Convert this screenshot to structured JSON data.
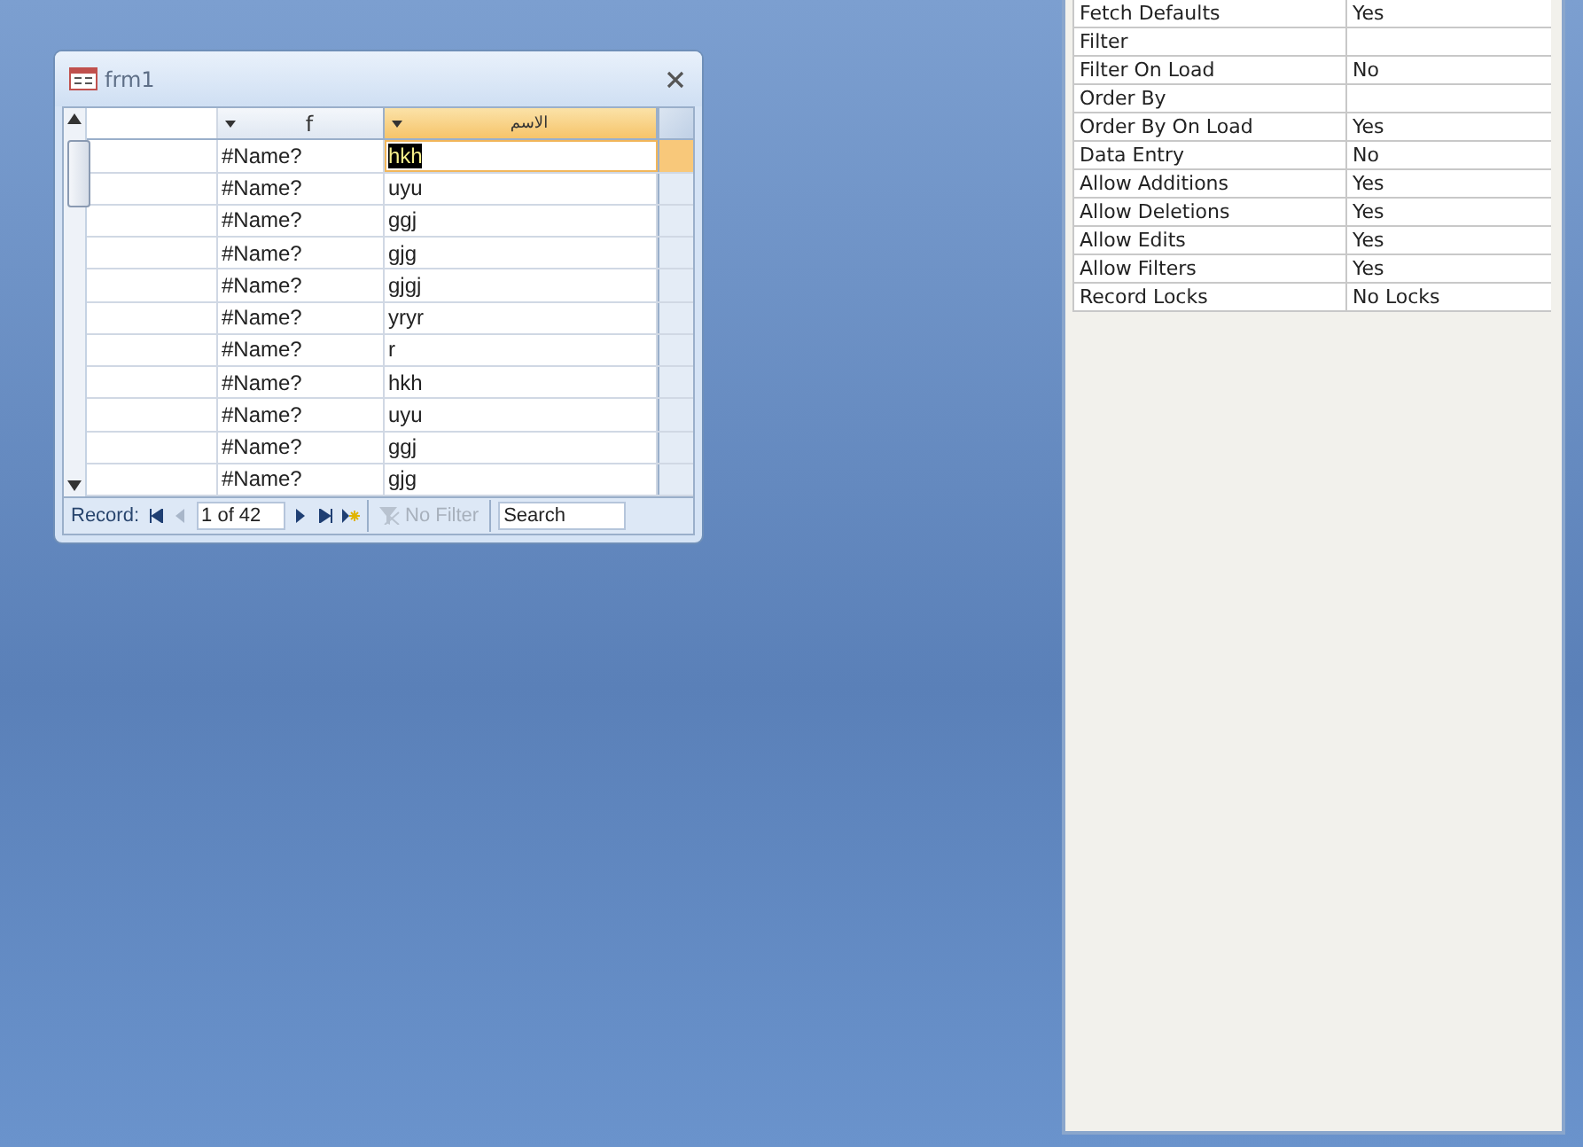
{
  "form": {
    "title": "frm1",
    "columns": [
      {
        "label": "f",
        "selected": false
      },
      {
        "label": "الاسم",
        "selected": true
      }
    ],
    "rows": [
      {
        "f": "#Name?",
        "name": "hkh",
        "selected": true
      },
      {
        "f": "#Name?",
        "name": "uyu",
        "selected": false
      },
      {
        "f": "#Name?",
        "name": "ggj",
        "selected": false
      },
      {
        "f": "#Name?",
        "name": "gjg",
        "selected": false
      },
      {
        "f": "#Name?",
        "name": "gjgj",
        "selected": false
      },
      {
        "f": "#Name?",
        "name": "yryr",
        "selected": false
      },
      {
        "f": "#Name?",
        "name": "r",
        "selected": false
      },
      {
        "f": "#Name?",
        "name": "hkh",
        "selected": false
      },
      {
        "f": "#Name?",
        "name": "uyu",
        "selected": false
      },
      {
        "f": "#Name?",
        "name": "ggj",
        "selected": false
      },
      {
        "f": "#Name?",
        "name": "gjg",
        "selected": false
      }
    ],
    "navigation": {
      "label": "Record:",
      "position": "1 of 42",
      "filter": "No Filter",
      "filter_disabled": true,
      "search_placeholder": "Search"
    }
  },
  "property_sheet": {
    "rows": [
      {
        "name": "Fetch Defaults",
        "value": "Yes"
      },
      {
        "name": "Filter"
      },
      {
        "name": "Filter On Load",
        "value": "No"
      },
      {
        "name": "Order By"
      },
      {
        "name": "Order By On Load",
        "value": "Yes"
      },
      {
        "name": "Data Entry",
        "value": "No"
      },
      {
        "name": "Allow Additions",
        "value": "Yes"
      },
      {
        "name": "Allow Deletions",
        "value": "Yes"
      },
      {
        "name": "Allow Edits",
        "value": "Yes"
      },
      {
        "name": "Allow Filters",
        "value": "Yes"
      },
      {
        "name": "Record Locks",
        "value": "No Locks"
      }
    ]
  }
}
